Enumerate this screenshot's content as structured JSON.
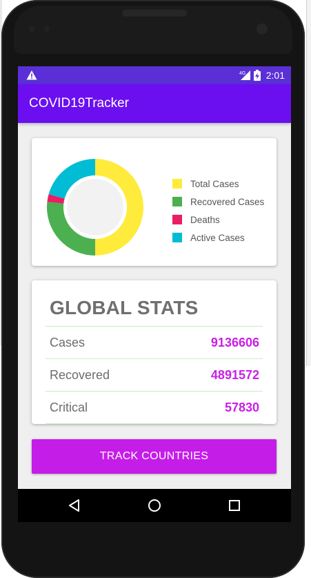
{
  "app": {
    "title": "COVID19Tracker"
  },
  "status_bar": {
    "time": "2:01",
    "network": "4G"
  },
  "chart_data": {
    "type": "pie",
    "series": [
      {
        "name": "Total Cases",
        "values": [
          9136606
        ]
      },
      {
        "name": "Recovered Cases",
        "values": [
          4891572
        ]
      },
      {
        "name": "Deaths",
        "values": [
          472000
        ]
      },
      {
        "name": "Active Cases",
        "values": [
          3773000
        ]
      }
    ],
    "colors": [
      "#ffeb3b",
      "#4caf50",
      "#e91e63",
      "#00bcd4"
    ],
    "legend": [
      "Total Cases",
      "Recovered Cases",
      "Deaths",
      "Active Cases"
    ],
    "legend_position": "right",
    "donut": true
  },
  "stats": {
    "title": "GLOBAL STATS",
    "rows": [
      {
        "label": "Cases",
        "value": "9136606"
      },
      {
        "label": "Recovered",
        "value": "4891572"
      },
      {
        "label": "Critical",
        "value": "57830"
      }
    ]
  },
  "button": {
    "label": "TRACK COUNTRIES"
  },
  "colors": {
    "status_bar": "#5a2fd6",
    "app_bar": "#6b0ff0",
    "accent": "#c51de8",
    "stat_value": "#c91fe6"
  },
  "icons": {
    "warning": "warning-icon",
    "back": "back-icon",
    "home": "home-icon",
    "recents": "recents-icon"
  }
}
